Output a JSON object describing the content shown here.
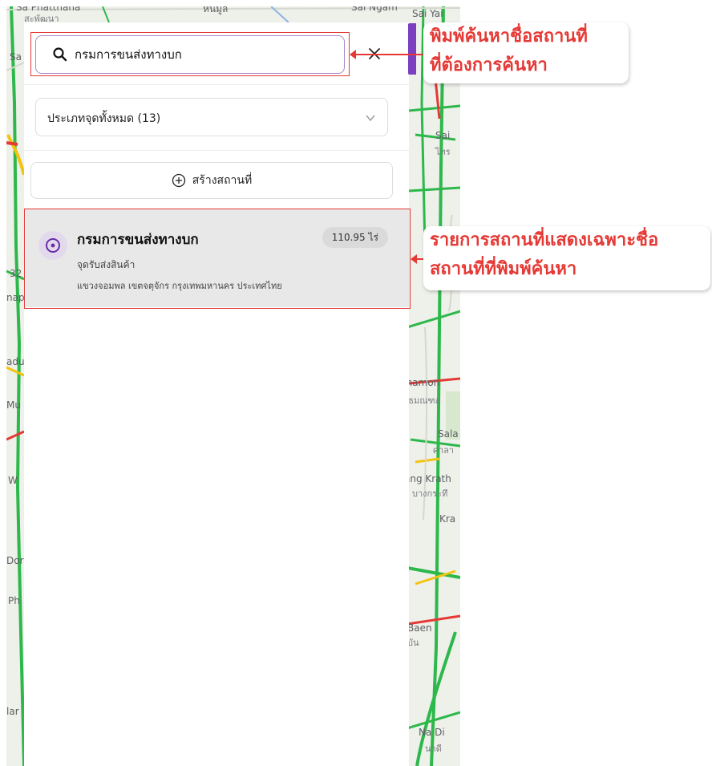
{
  "search": {
    "value": "กรมการขนส่งทางบก",
    "placeholder": "กรมการขนส่งทางบก"
  },
  "filter": {
    "label": "ประเภทจุดทั้งหมด (13)"
  },
  "create": {
    "label": "สร้างสถานที่"
  },
  "result": {
    "title": "กรมการขนส่งทางบก",
    "type": "จุดรับส่งสินค้า",
    "address": "แขวงจอมพล เขตจตุจักร กรุงเทพมหานคร ประเทศไทย",
    "area": "110.95 ไร่"
  },
  "callouts": {
    "search_line1": "พิมพ์ค้นหาชื่อสถานที่",
    "search_line2": "ที่ต้องการค้นหา",
    "result_line1": "รายการสถานที่แสดงเฉพาะชื่อ",
    "result_line2": "สถานที่ที่พิมพ์ค้นหา"
  },
  "map_labels": {
    "sa_phatthana": "Sa Phatthana",
    "sa_phatthana_th": "สะพัฒนา",
    "nong": "หนมูล",
    "sai_ngam": "Sai Ngam",
    "sai_yai": "Sai Yai",
    "sai": "Sai",
    "sai_th": "ไทร",
    "thamon": "thamon",
    "thamon_th": "ทธมณฑล",
    "sala": "Sala",
    "sala_th": "ศาลา",
    "bang_krathuek": "ang Krath",
    "bang_krathuek_th": "บางกระทึ",
    "kra": "Kra",
    "baen": "Baen",
    "baen_th": "บัน",
    "na_di": "Na Di",
    "na_di_th": "นาดี",
    "left_sa": "Sa",
    "left_32": "32",
    "left_nap": "nap",
    "left_du": "adu",
    "left_mu": "Mu",
    "left_w": "W",
    "left_dor": "Dor",
    "left_ph": "Ph",
    "left_lar": "lar"
  },
  "colors": {
    "accent_purple": "#7c3fbf",
    "annotation_red": "#e53935",
    "road_green": "#2db84b",
    "road_yellow": "#f2c30f",
    "road_red": "#e53935"
  },
  "icons": {
    "search": "magnifier",
    "clear": "x-mark",
    "chevron": "chevron-down",
    "create": "plus-circle",
    "place": "target-dot"
  }
}
